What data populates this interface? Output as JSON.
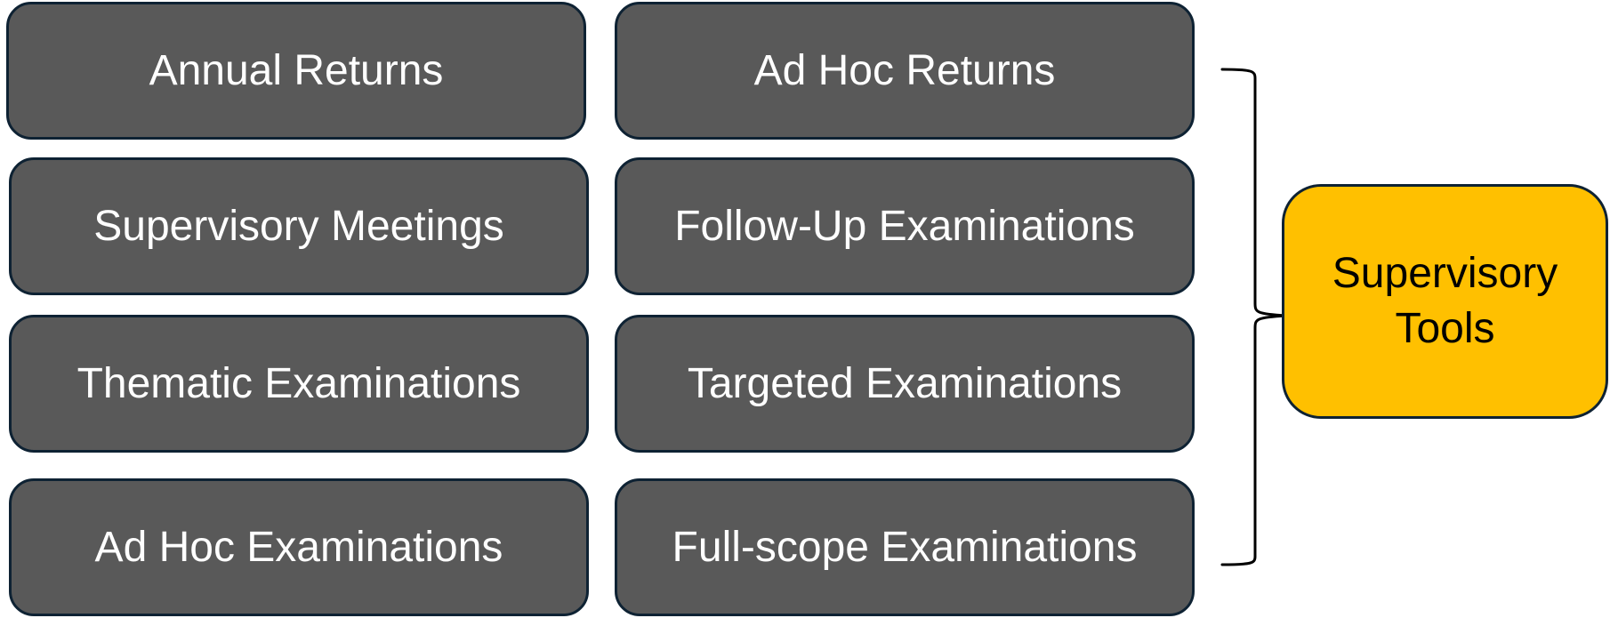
{
  "tools": {
    "left_column": [
      "Annual Returns",
      "Supervisory Meetings",
      "Thematic Examinations",
      "Ad Hoc Examinations"
    ],
    "right_column": [
      "Ad Hoc Returns",
      "Follow-Up Examinations",
      "Targeted Examinations",
      "Full-scope Examinations"
    ]
  },
  "summary": {
    "label_line1": "Supervisory",
    "label_line2": "Tools"
  },
  "colors": {
    "tool_box_fill": "#595959",
    "tool_box_text": "#ffffff",
    "summary_fill": "#ffc000",
    "border": "#0e2233"
  },
  "icons": {
    "connector": "curly-brace"
  }
}
